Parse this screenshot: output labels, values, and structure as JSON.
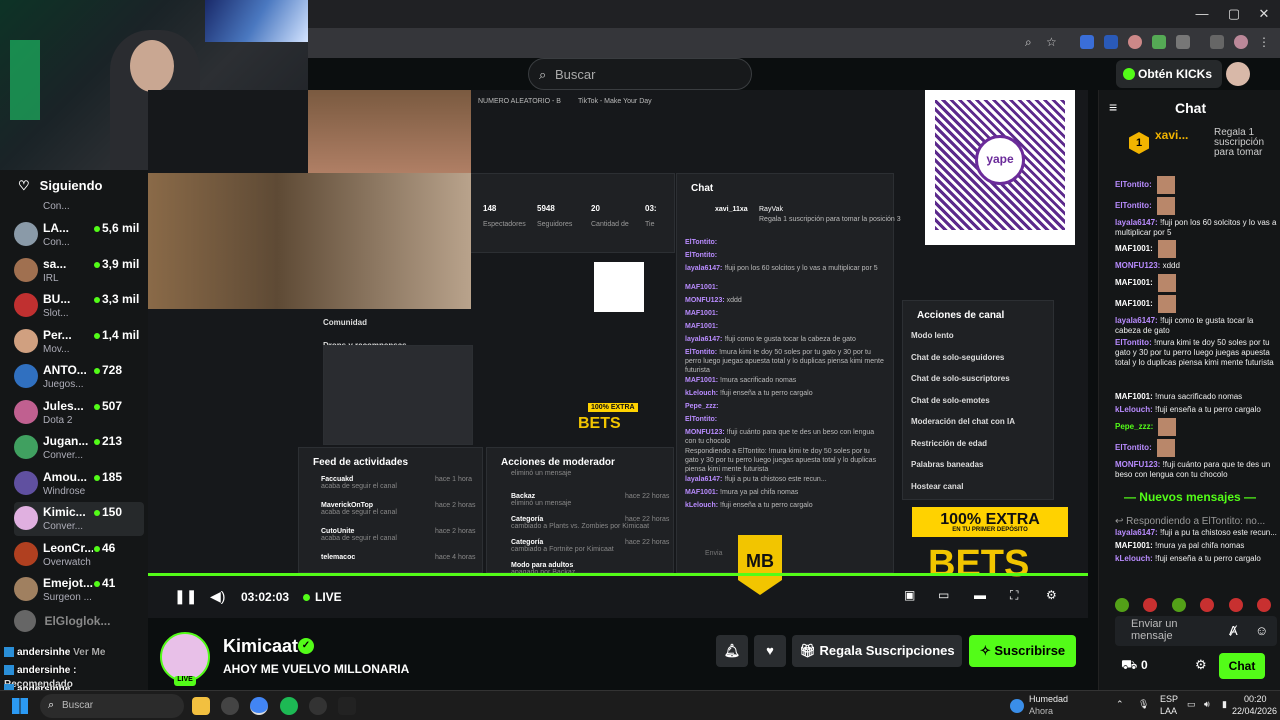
{
  "browser": {
    "window_controls": [
      "—",
      "▢",
      "✕"
    ]
  },
  "header": {
    "search_placeholder": "Buscar",
    "get_kicks_label": "Obtén KICKs"
  },
  "sidebar": {
    "title": "Siguiendo",
    "partial_row": "Con...",
    "items": [
      {
        "name": "LA...",
        "category": "Con...",
        "viewers": "5,6 mil",
        "color": "#8a9aa8"
      },
      {
        "name": "sa...",
        "category": "IRL",
        "viewers": "3,9 mil",
        "color": "#a07050"
      },
      {
        "name": "BU...",
        "category": "Slot...",
        "viewers": "3,3 mil",
        "color": "#c03030"
      },
      {
        "name": "Per...",
        "category": "Mov...",
        "viewers": "1,4 mil",
        "color": "#d0a080"
      },
      {
        "name": "ANTO...",
        "category": "Juegos...",
        "viewers": "728",
        "color": "#3070c0"
      },
      {
        "name": "Jules...",
        "category": "Dota 2",
        "viewers": "507",
        "color": "#c06090"
      },
      {
        "name": "Jugan...",
        "category": "Conver...",
        "viewers": "213",
        "color": "#40a060"
      },
      {
        "name": "Amou...",
        "category": "Windrose",
        "viewers": "185",
        "color": "#6050a0"
      },
      {
        "name": "Kimic...",
        "category": "Conver...",
        "viewers": "150",
        "color": "#e0b0e0"
      },
      {
        "name": "LeonCr...",
        "category": "Overwatch",
        "viewers": "46",
        "color": "#b04020"
      },
      {
        "name": "Emejot...",
        "category": "Surgeon ...",
        "viewers": "41",
        "color": "#a08060"
      }
    ],
    "offline": "ElGloglok...",
    "recommended": "Recomendado"
  },
  "overlay_chat": [
    {
      "user": "andersinhe",
      "text": "Ver Me"
    },
    {
      "user": "andersinhe :",
      "text": ""
    },
    {
      "user": "andersinhe",
      "text": ""
    }
  ],
  "video": {
    "time": "03:02:03",
    "live": "LIVE",
    "nested": {
      "tab1": "NUMERO ALEATORIO - B",
      "tab2": "TikTok - Make Your Day",
      "stats": [
        {
          "value": "148",
          "label": "Espectadores"
        },
        {
          "value": "5948",
          "label": "Seguidores"
        },
        {
          "value": "20",
          "label": "Cantidad de"
        },
        {
          "value": "03:",
          "label": "Tie"
        }
      ],
      "community": "Comunidad",
      "drops": "Drops y recompensas",
      "chat_title": "Chat",
      "pinned_user": "xavi_11xa",
      "pinned_by": "RayVak",
      "pinned_text": "Regala 1 suscripción para tomar la posición 3",
      "chat_lines": [
        {
          "user": "ElTontito:",
          "text": ""
        },
        {
          "user": "ElTontito:",
          "text": ""
        },
        {
          "user": "layala6147:",
          "text": "!fuji pon los 60 solcitos y lo vas a multiplicar por 5"
        },
        {
          "user": "MAF1001:",
          "text": ""
        },
        {
          "user": "MONFU123:",
          "text": "xddd"
        },
        {
          "user": "MAF1001:",
          "text": ""
        },
        {
          "user": "MAF1001:",
          "text": ""
        },
        {
          "user": "layala6147:",
          "text": "!fuji como te gusta tocar la cabeza de gato"
        },
        {
          "user": "ElTontito:",
          "text": "!mura kimi te doy 50 soles por tu gato y 30 por tu perro luego juegas apuesta total y lo duplicas piensa kimi mente futurista"
        },
        {
          "user": "MAF1001:",
          "text": "!mura sacrificado nomas"
        },
        {
          "user": "kLelouch:",
          "text": "!fuji enseña a tu perro cargalo"
        },
        {
          "user": "Pepe_zzz:",
          "text": ""
        },
        {
          "user": "ElTontito:",
          "text": ""
        },
        {
          "user": "MONFU123:",
          "text": "!fuji cuánto para que te des un beso con lengua con tu chocolo"
        },
        {
          "user": "",
          "text": "Respondiendo a ElTontito: !mura kimi te doy 50 soles por tu gato y 30 por tu perro luego juegas apuesta total y lo duplicas piensa kimi mente futurista"
        },
        {
          "user": "layala6147:",
          "text": "!fuji a pu ta chistoso este recun..."
        },
        {
          "user": "MAF1001:",
          "text": "!mura ya pal chifa nomas"
        },
        {
          "user": "kLelouch:",
          "text": "!fuji enseña a tu perro cargalo"
        }
      ],
      "send_label": "Envia",
      "activity_title": "Feed de actividades",
      "activity": [
        {
          "user": "Faccuakd",
          "text": "acaba de seguir el canal",
          "time": "hace 1 hora"
        },
        {
          "user": "MaverickOnTop",
          "text": "acaba de seguir el canal",
          "time": "hace 2 horas"
        },
        {
          "user": "CutoUnite",
          "text": "acaba de seguir el canal",
          "time": "hace 2 horas"
        },
        {
          "user": "telemacoc",
          "text": "",
          "time": "hace 4 horas"
        }
      ],
      "mod_title": "Acciones de moderador",
      "mod_actions": [
        {
          "user": "",
          "text": "eliminó un mensaje",
          "time": ""
        },
        {
          "user": "Backaz",
          "text": "eliminó un mensaje",
          "time": "hace 22 horas"
        },
        {
          "user": "Categoría",
          "text": "cambiado a Plants vs. Zombies por Kimicaat",
          "time": "hace 22 horas"
        },
        {
          "user": "Categoría",
          "text": "cambiado a Fortnite por Kimicaat",
          "time": "hace 22 horas"
        },
        {
          "user": "Modo para adultos",
          "text": "apagado por Backaz",
          "time": ""
        }
      ],
      "channel_actions_title": "Acciones de canal",
      "channel_actions": [
        "Modo lento",
        "Chat de solo-seguidores",
        "Chat de solo-suscriptores",
        "Chat de solo-emotes",
        "Moderación del chat con IA",
        "Restricción de edad",
        "Palabras baneadas",
        "Hostear canal"
      ],
      "extra_small": "100% EXTRA",
      "bets_small": "BETS",
      "qr_label": "yape"
    },
    "banner": "100% EXTRA",
    "banner_sub": "EN TU PRIMER DEPÓSITO",
    "mb": "MB",
    "bets": "BETS"
  },
  "channel": {
    "name": "Kimicaat",
    "title": "AHOY ME VUELVO MILLONARIA",
    "live_badge": "LIVE",
    "gift_label": "Regala Suscripciones",
    "subscribe_label": "Suscribirse"
  },
  "chat": {
    "title": "Chat",
    "pinned_user": "xavi...",
    "pinned_rank": "1",
    "pinned_text": "Regala 1 suscripción para tomar",
    "messages": [
      {
        "user": "ElTontito:",
        "text": "",
        "color": "#b98cff"
      },
      {
        "user": "ElTontito:",
        "text": "",
        "color": "#b98cff"
      },
      {
        "user": "layala6147:",
        "text": "!fuji pon los 60 solcitos y lo vas a multiplicar por 5",
        "color": "#b98cff"
      },
      {
        "user": "MAF1001:",
        "text": "",
        "color": "#ffffff"
      },
      {
        "user": "MONFU123:",
        "text": "xddd",
        "color": "#b98cff"
      },
      {
        "user": "MAF1001:",
        "text": "",
        "color": "#ffffff"
      },
      {
        "user": "MAF1001:",
        "text": "",
        "color": "#ffffff"
      },
      {
        "user": "layala6147:",
        "text": "!fuji como te gusta tocar la cabeza de gato",
        "color": "#b98cff"
      },
      {
        "user": "ElTontito:",
        "text": "!mura kimi te doy 50 soles por tu gato y 30 por tu perro luego juegas apuesta total y lo duplicas piensa kimi mente futurista",
        "color": "#b98cff"
      },
      {
        "user": "MAF1001:",
        "text": "!mura sacrificado nomas",
        "color": "#ffffff"
      },
      {
        "user": "kLelouch:",
        "text": "!fuji enseña a tu perro cargalo",
        "color": "#b98cff"
      },
      {
        "user": "Pepe_zzz:",
        "text": "",
        "color": "#53fc18"
      },
      {
        "user": "ElTontito:",
        "text": "",
        "color": "#b98cff"
      },
      {
        "user": "MONFU123:",
        "text": "!fuji cuánto para que te des un beso con lengua con tu chocolo",
        "color": "#b98cff"
      }
    ],
    "new_messages": "Nuevos mensajes",
    "reply_text": "Respondiendo a ElTontito: no...",
    "messages2": [
      {
        "user": "layala6147:",
        "text": "!fuji a pu ta chistoso este recun...",
        "color": "#b98cff"
      },
      {
        "user": "MAF1001:",
        "text": "!mura ya pal chifa nomas",
        "color": "#ffffff"
      },
      {
        "user": "kLelouch:",
        "text": "!fuji enseña a tu perro cargalo",
        "color": "#b98cff"
      }
    ],
    "input_placeholder": "Enviar un mensaje",
    "kicks_count": "0",
    "send_label": "Chat"
  },
  "taskbar": {
    "search_placeholder": "Buscar",
    "weather_title": "Humedad",
    "weather_sub": "Ahora",
    "lang": "ESP",
    "lang_sub": "LAA",
    "time": "00:20",
    "date": "22/04/2026"
  }
}
